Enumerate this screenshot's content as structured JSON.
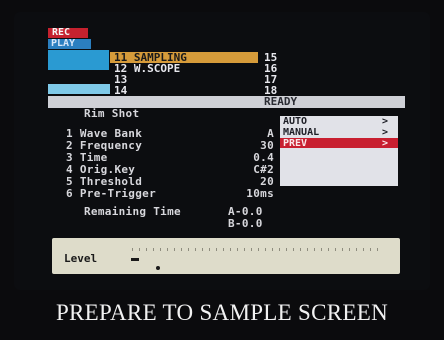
{
  "header": {
    "mode_rec": "REC",
    "mode_play": "PLAY",
    "params_left": [
      "11 SAMPLING",
      "12 W.SCOPE",
      "13",
      "14"
    ],
    "params_right": [
      "15",
      "16",
      "17",
      "18"
    ],
    "status": "READY"
  },
  "sample_name": "Rim Shot",
  "settings": [
    {
      "label": "1 Wave Bank",
      "value": "A"
    },
    {
      "label": "2 Frequency",
      "value": "30"
    },
    {
      "label": "3 Time",
      "value": "0.4"
    },
    {
      "label": "4 Orig.Key",
      "value": "C#2"
    },
    {
      "label": "5 Threshold",
      "value": "20"
    },
    {
      "label": "6 Pre-Trigger",
      "value": "10ms"
    }
  ],
  "menu": {
    "items": [
      "AUTO",
      "MANUAL",
      "PREV"
    ],
    "arrows": [
      ">",
      ">",
      ">"
    ],
    "selected_index": 2
  },
  "remaining": {
    "label": "Remaining Time",
    "a": "A-0.0",
    "b": "B-0.0"
  },
  "level": {
    "label": "Level"
  },
  "caption": "PREPARE TO SAMPLE SCREEN",
  "colors": {
    "rec": "#c5212e",
    "selected_row": "#d69b3a",
    "menu_highlight": "#c81f30"
  }
}
